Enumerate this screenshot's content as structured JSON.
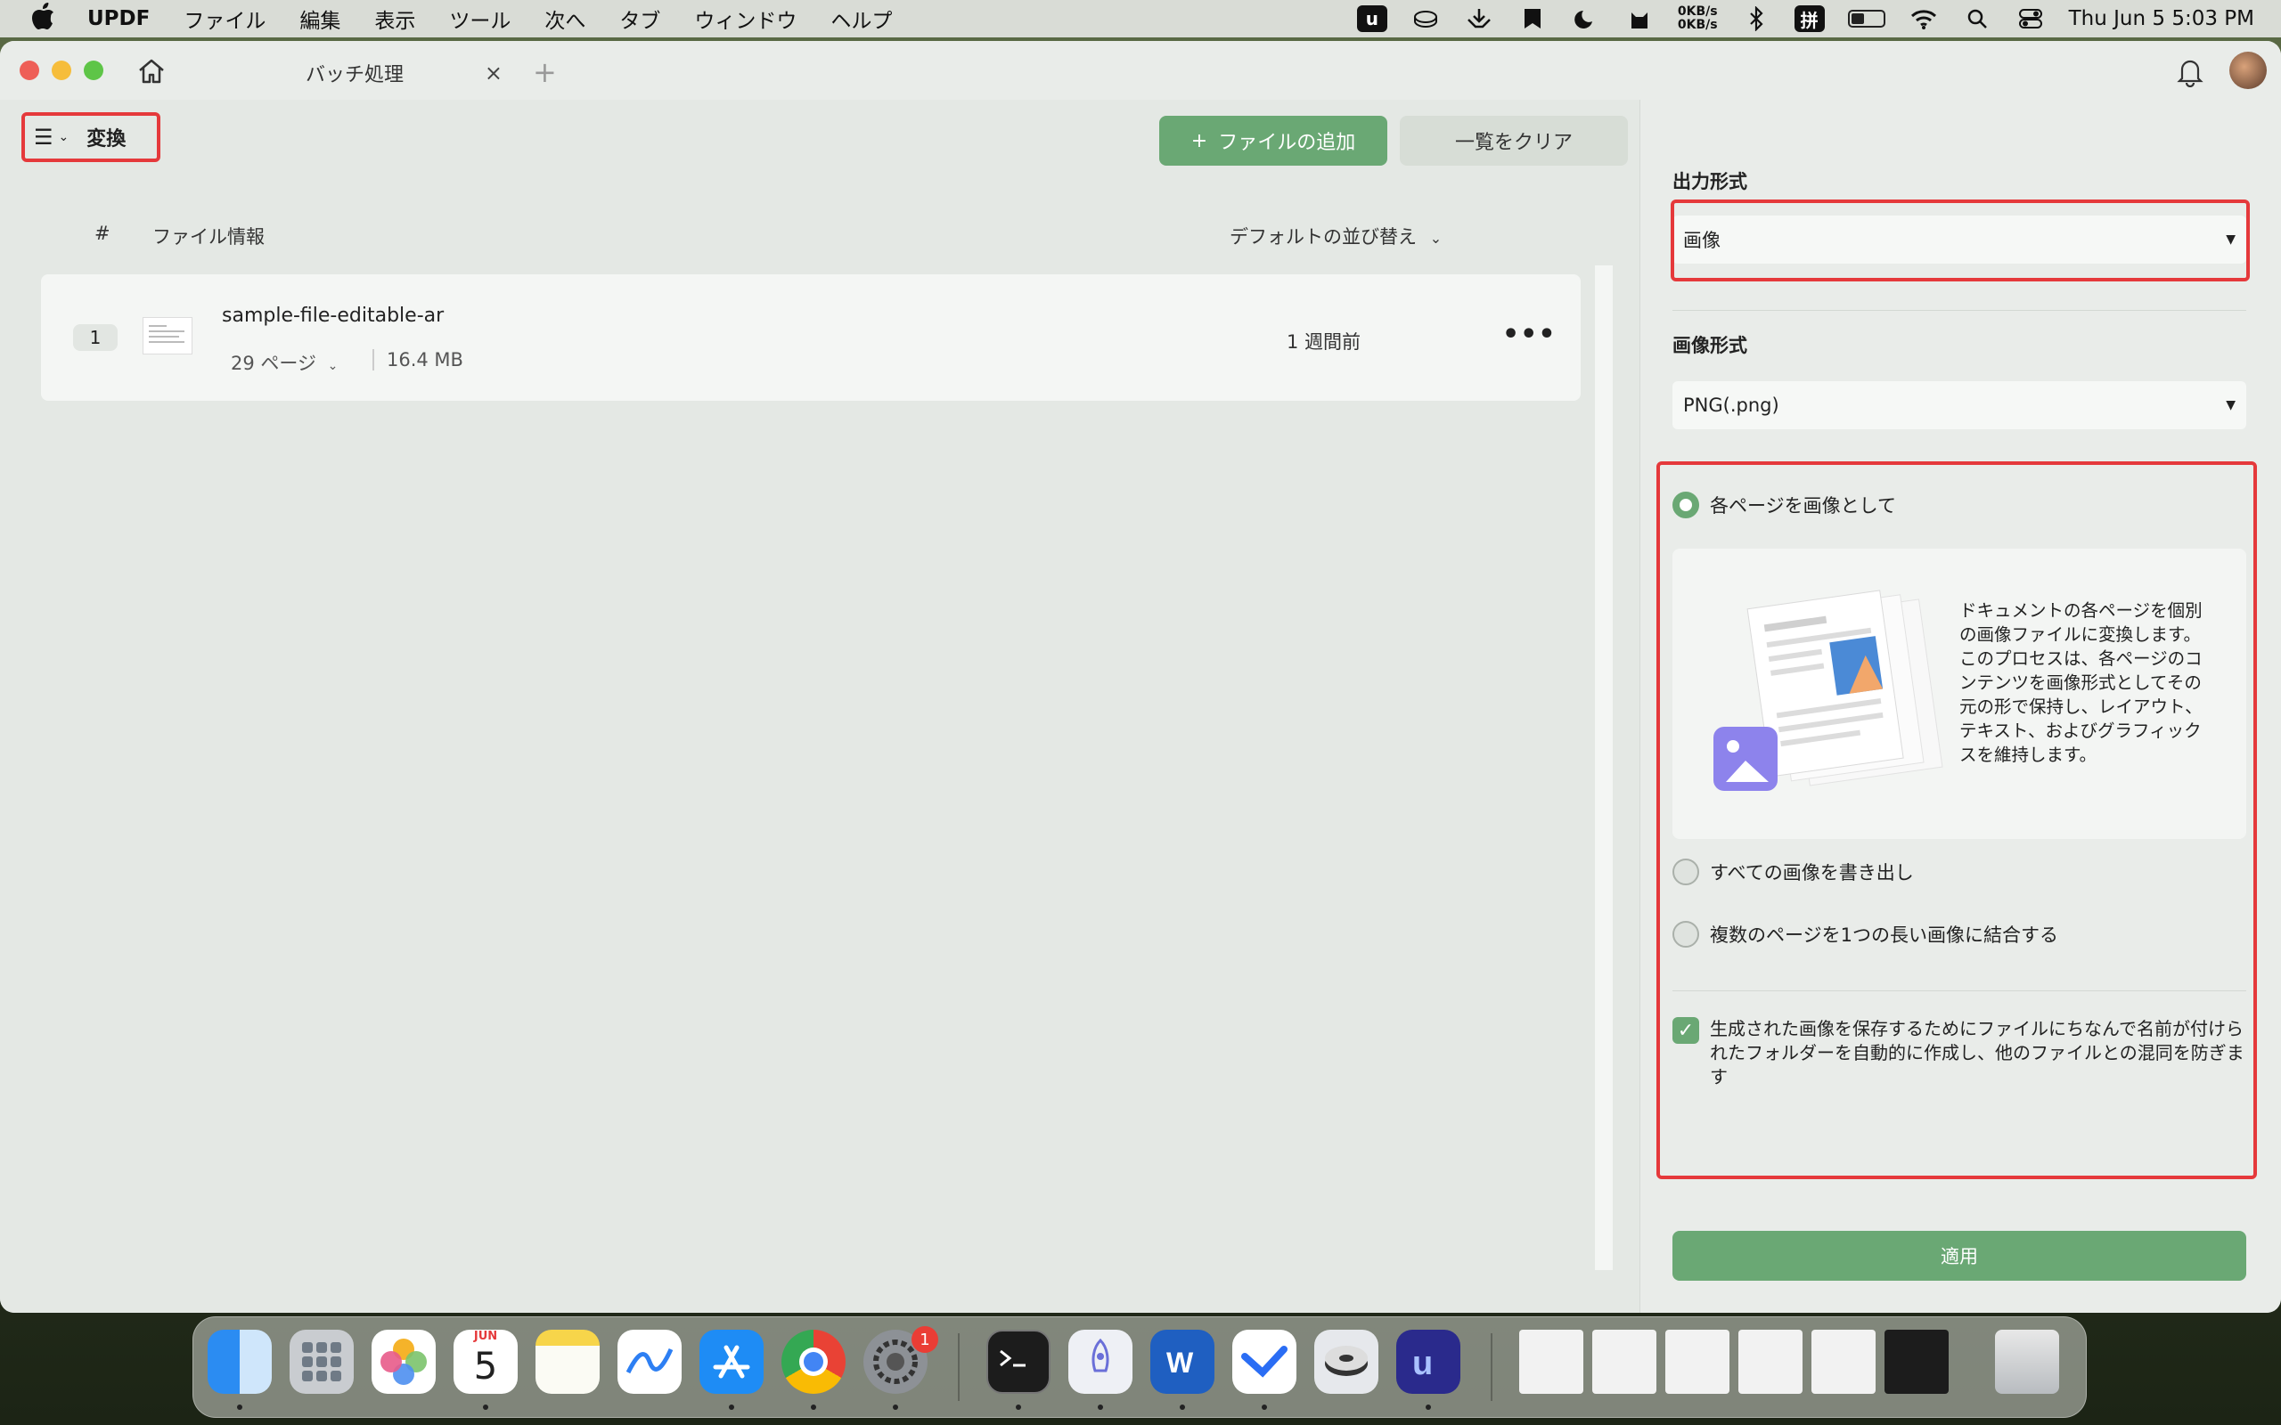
{
  "menubar": {
    "app_name": "UPDF",
    "items": [
      "ファイル",
      "編集",
      "表示",
      "ツール",
      "次へ",
      "タブ",
      "ウィンドウ",
      "ヘルプ"
    ],
    "net_up": "0KB/s",
    "net_down": "0KB/s",
    "datetime": "Thu Jun 5  5:03 PM"
  },
  "window": {
    "tab_title": "バッチ処理",
    "tab_close": "×",
    "tab_add": "+"
  },
  "toolbar": {
    "mode_label": "変換",
    "add_file_label": "ファイルの追加",
    "add_icon": "+",
    "clear_label": "一覧をクリア"
  },
  "list": {
    "col_number": "#",
    "col_info": "ファイル情報",
    "sort_label": "デフォルトの並び替え",
    "rows": [
      {
        "number": "1",
        "name": "sample-file-editable-ar",
        "pages": "29 ページ",
        "size": "16.4 MB",
        "time": "1 週間前",
        "more": "•••"
      }
    ]
  },
  "panel": {
    "output_format_label": "出力形式",
    "output_format_value": "画像",
    "image_format_label": "画像形式",
    "image_format_value": "PNG(.png)",
    "option_each_page": "各ページを画像として",
    "option_each_page_desc": "ドキュメントの各ページを個別の画像ファイルに変換します。このプロセスは、各ページのコンテンツを画像形式としてその元の形で保持し、レイアウト、テキスト、およびグラフィックスを維持します。",
    "option_export_images": "すべての画像を書き出し",
    "option_merge_pages": "複数のページを1つの長い画像に結合する",
    "checkbox_folder": "生成された画像を保存するためにファイルにちなんで名前が付けられたフォルダーを自動的に作成し、他のファイルとの混同を防ぎます",
    "apply_label": "適用",
    "selected_option": "each_page",
    "checkbox_checked": true
  },
  "dock": {
    "calendar_month": "JUN",
    "calendar_day": "5",
    "settings_badge": "1",
    "apps": [
      "finder",
      "launchpad",
      "photos",
      "calendar",
      "notes",
      "freeform",
      "app-store",
      "chrome",
      "system-settings",
      "terminal",
      "rocket",
      "word",
      "lark",
      "disk-utility",
      "updf"
    ]
  },
  "colors": {
    "accent_green": "#6aa874",
    "highlight_red": "#e5393b"
  }
}
